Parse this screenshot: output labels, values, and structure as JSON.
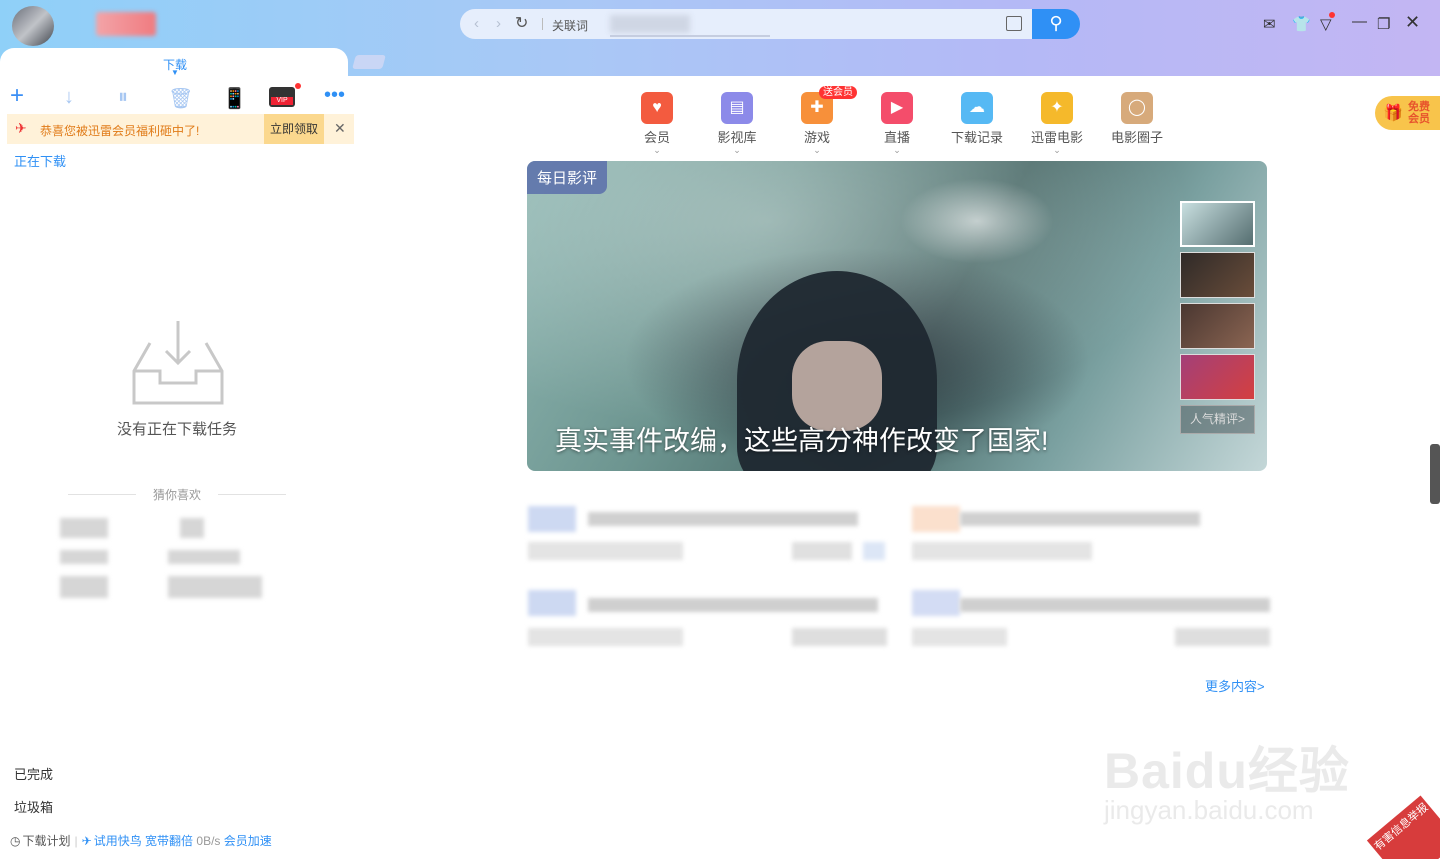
{
  "titlebar": {
    "address_keyword_label": "关联词",
    "window_controls": [
      "mail-icon",
      "skin-icon",
      "download-menu-icon",
      "minimize-icon",
      "restore-icon",
      "close-icon"
    ]
  },
  "download_tab": {
    "label": "下载"
  },
  "toolbar": {
    "add": "+",
    "start": "↓",
    "pause": "⏸",
    "delete": "🗑",
    "phone": "📱",
    "vip": "VIP",
    "more": "•••"
  },
  "banner": {
    "text": "恭喜您被迅雷会员福利砸中了!",
    "claim_label": "立即领取",
    "close": "✕"
  },
  "left": {
    "downloading_label": "正在下载",
    "empty_text": "没有正在下载任务",
    "guess_label": "猜你喜欢",
    "completed_label": "已完成",
    "trash_label": "垃圾箱"
  },
  "footer": {
    "plan_label": "下载计划",
    "trial_label": "试用快鸟",
    "bandwidth_label": "宽带翻倍",
    "speed": "0B/s",
    "accel_label": "会员加速"
  },
  "nav": [
    {
      "label": "会员",
      "icon": "vip-icon"
    },
    {
      "label": "影视库",
      "icon": "film-library-icon"
    },
    {
      "label": "游戏",
      "icon": "game-icon",
      "badge": "送会员"
    },
    {
      "label": "直播",
      "icon": "live-icon"
    },
    {
      "label": "下载记录",
      "icon": "cloud-icon"
    },
    {
      "label": "迅雷电影",
      "icon": "movie-icon"
    },
    {
      "label": "电影圈子",
      "icon": "circle-icon"
    }
  ],
  "gift": {
    "text": "免费会员"
  },
  "hero": {
    "tag": "每日影评",
    "title": "真实事件改编，这些高分神作改变了国家!",
    "more_reviews": "人气精评>"
  },
  "more_content": "更多内容>",
  "watermark": {
    "big": "Baidu经验",
    "small": "jingyan.baidu.com"
  },
  "report": "有害信息举报",
  "colors": {
    "accent": "#2f90f5",
    "banner_bg": "#fff2d9",
    "claim_bg": "#fbd88e"
  }
}
